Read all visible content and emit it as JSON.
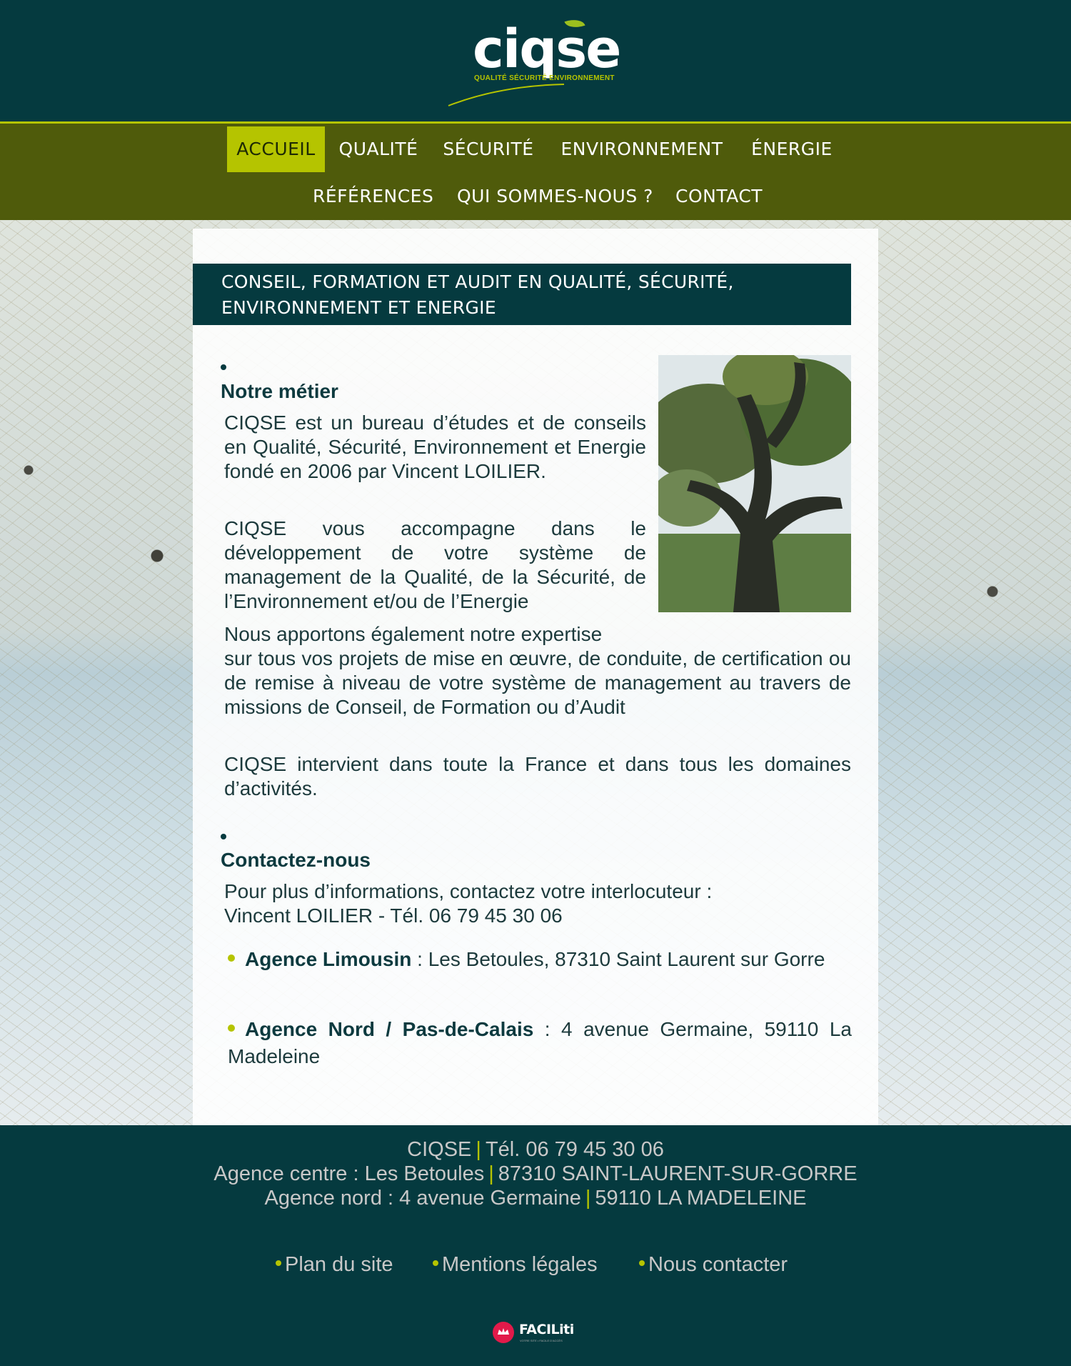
{
  "header": {
    "logo_word": "ciqse",
    "logo_tagline": "QUALITÉ SÉCURITÉ ENVIRONNEMENT"
  },
  "nav": {
    "items": [
      {
        "label": "ACCUEIL",
        "active": true
      },
      {
        "label": "QUALITÉ"
      },
      {
        "label": "SÉCURITÉ"
      },
      {
        "label": "ENVIRONNEMENT"
      },
      {
        "label": "ÉNERGIE"
      },
      {
        "label": "RÉFÉRENCES"
      },
      {
        "label": "QUI SOMMES-NOUS ?"
      },
      {
        "label": "CONTACT"
      }
    ]
  },
  "main": {
    "banner": "CONSEIL, FORMATION ET AUDIT EN QUALITÉ, SÉCURITÉ, ENVIRONNEMENT ET ENERGIE",
    "metier_title": "Notre métier",
    "metier_paragraphs": [
      "CIQSE est un bureau d’études et de conseils en Qualité, Sécurité, Environnement et Energie fondé en 2006 par Vincent LOILIER.",
      "CIQSE vous accompagne dans le développement de votre système de management de la Qualité, de la Sécurité, de l’Environnement et/ou de l’Energie",
      "Nous apportons également notre expertise",
      "sur tous vos projets de mise en œuvre, de conduite, de certification ou de remise à niveau de votre système de management au travers de missions de Conseil, de Formation ou d’Audit",
      "CIQSE intervient dans toute la France et dans tous les domaines d’activités."
    ],
    "contact_title": "Contactez-nous",
    "contact_intro_line1": "Pour plus d’informations, contactez votre interlocuteur :",
    "contact_intro_line2": "Vincent LOILIER - Tél. 06 79 45 30 06",
    "agencies": [
      {
        "name": "Agence Limousin",
        "address": " : Les Betoules, 87310 Saint Laurent sur Gorre"
      },
      {
        "name": "Agence Nord / Pas-de-Calais",
        "address": " : 4 avenue Germaine, 59110 La Madeleine"
      }
    ]
  },
  "footer": {
    "line1_a": "CIQSE",
    "line1_b": "Tél. 06 79 45 30 06",
    "line2_a": "Agence centre : Les Betoules",
    "line2_b": "87310 SAINT-LAURENT-SUR-GORRE",
    "line3_a": "Agence nord : 4 avenue Germaine",
    "line3_b": "59110 LA MADELEINE",
    "separator": "|",
    "links": [
      "Plan du site",
      "Mentions légales",
      "Nous contacter"
    ],
    "badge": "FACILiti",
    "badge_sub": "VOTRE SITE • FACILE D'ACCÈS"
  },
  "colors": {
    "primary": "#053a3f",
    "accent": "#b5c400",
    "nav_bg": "#4f5b0b"
  }
}
